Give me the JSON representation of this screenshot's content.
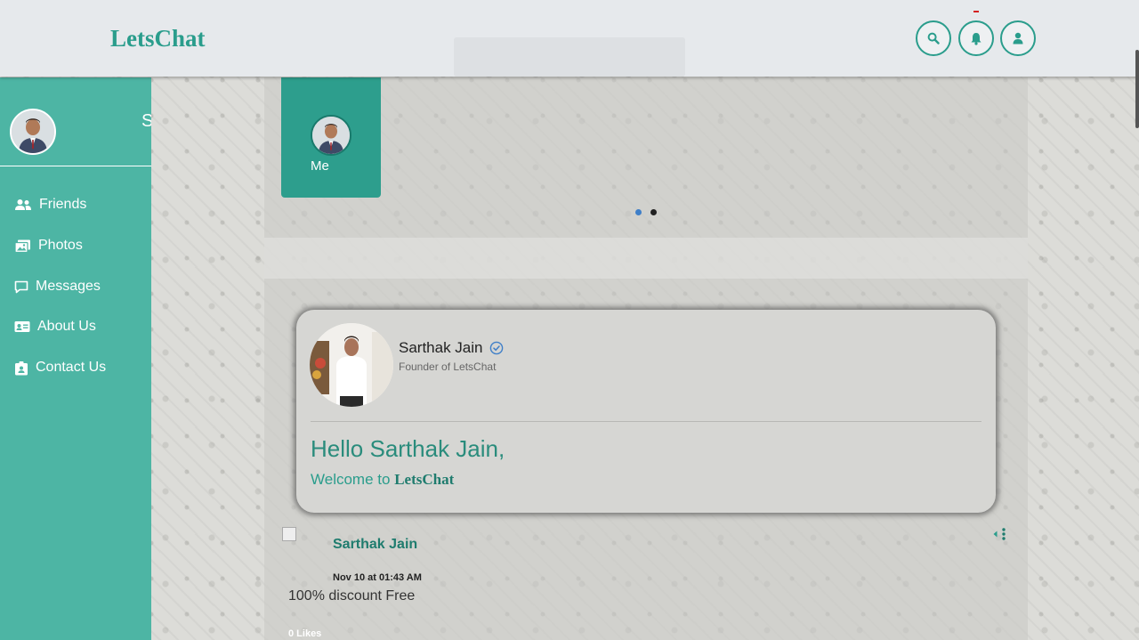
{
  "app": {
    "title": "LetsChat"
  },
  "header": {
    "search_icon": "search-icon",
    "bell_icon": "bell-icon",
    "user_icon": "user-icon",
    "accent_color": "#2a9d8c"
  },
  "sidebar": {
    "user_name_partial": "S",
    "items": [
      {
        "label": "Friends",
        "icon": "users-icon"
      },
      {
        "label": "Photos",
        "icon": "photos-icon"
      },
      {
        "label": "Messages",
        "icon": "message-icon"
      },
      {
        "label": "About Us",
        "icon": "id-card-icon"
      },
      {
        "label": "Contact Us",
        "icon": "contact-icon"
      }
    ],
    "background_color": "#4db5a4"
  },
  "stories": {
    "me_label": "Me",
    "active_dot_color": "#3f7fc8",
    "inactive_dot_color": "#222222"
  },
  "profile": {
    "name": "Sarthak Jain",
    "role": "Founder of LetsChat",
    "greeting": "Hello Sarthak Jain,",
    "welcome_prefix": "Welcome to",
    "welcome_brand": "LetsChat"
  },
  "post": {
    "author": "Sarthak Jain",
    "timestamp": "Nov 10 at 01:43 AM",
    "text": "100% discount Free",
    "likes": "0 Likes"
  }
}
